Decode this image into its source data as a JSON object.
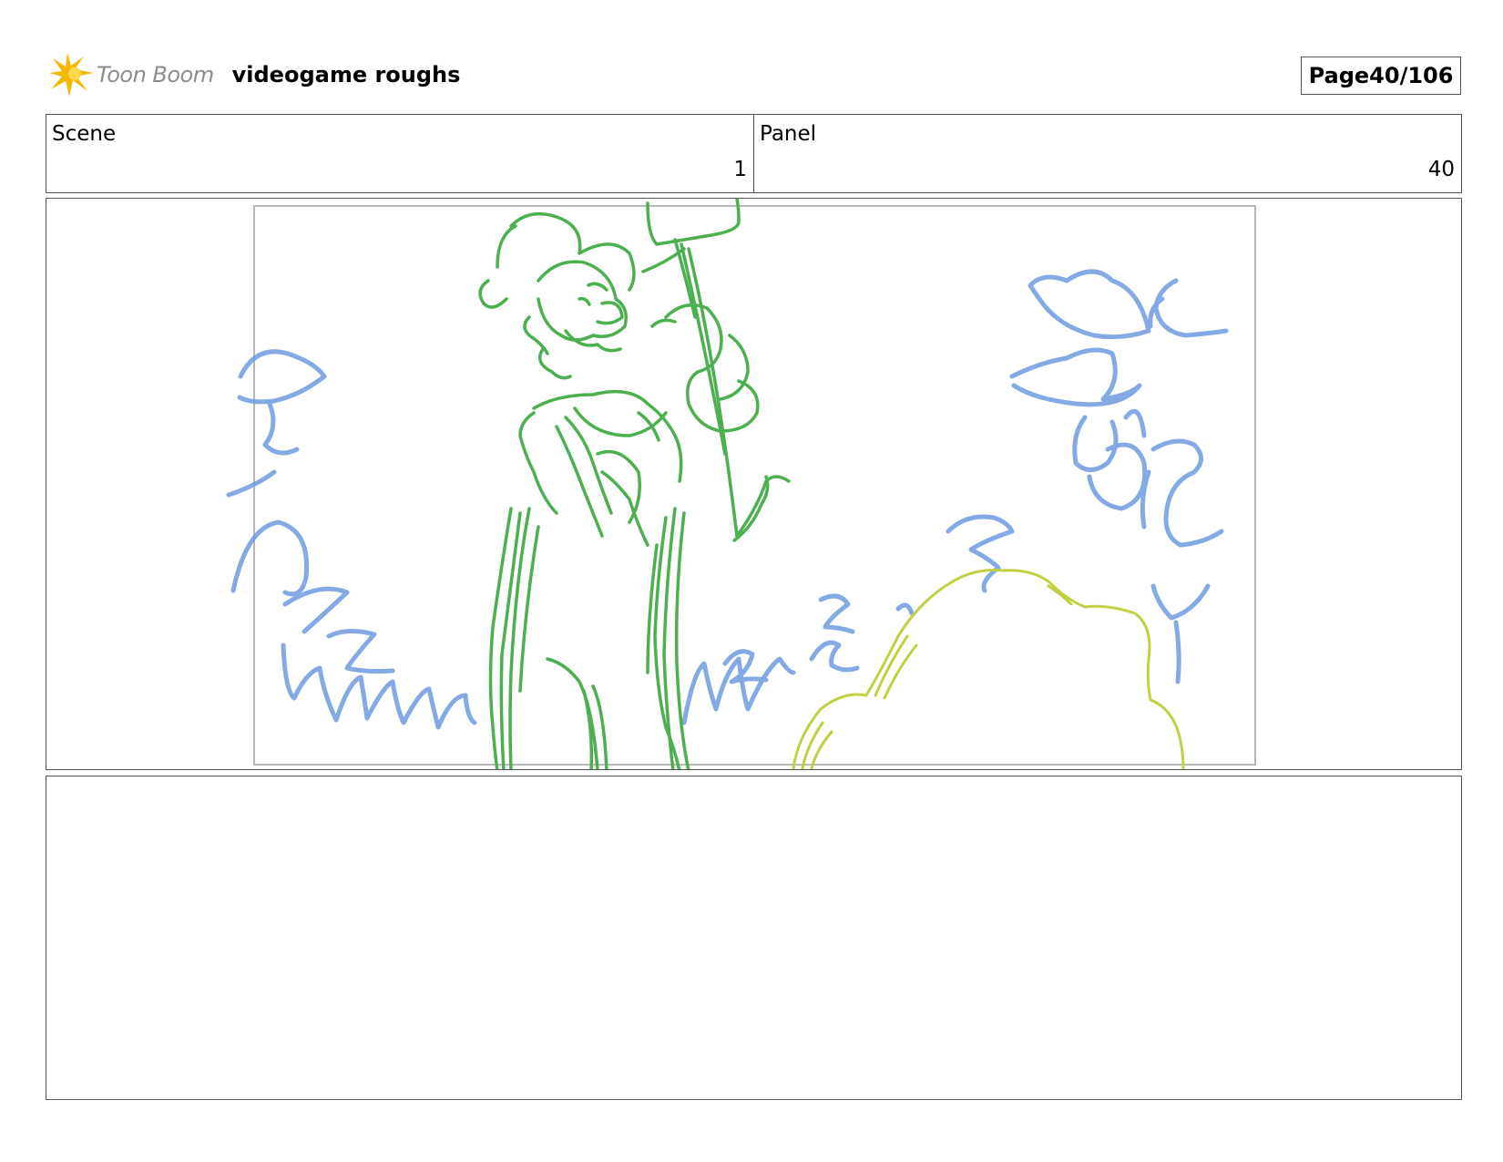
{
  "header": {
    "logo_text": "Toon Boom",
    "project_title": "videogame roughs",
    "page_label": "Page",
    "page_number": "40/106"
  },
  "meta": {
    "scene_label": "Scene",
    "scene_value": "1",
    "panel_label": "Panel",
    "panel_value": "40"
  },
  "panel_image": {
    "description_icon": "storyboard-sketch",
    "colors": {
      "character": "#4caf50",
      "foliage": "#6f9be0",
      "bush": "#c2cf40",
      "frame": "#b8b8b8",
      "logo_burst": "#f5b800"
    }
  },
  "notes": {
    "text": ""
  }
}
